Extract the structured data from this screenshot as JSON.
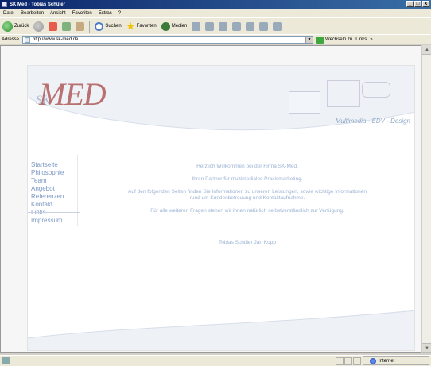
{
  "window": {
    "title": "SK Med - Tobias Schüler",
    "min": "_",
    "max": "□",
    "close": "x"
  },
  "menu": [
    "Datei",
    "Bearbeiten",
    "Ansicht",
    "Favoriten",
    "Extras",
    "?"
  ],
  "toolbar": {
    "back": "Zurück",
    "search": "Suchen",
    "favorites": "Favoriten",
    "media": "Medien"
  },
  "address": {
    "label": "Adresse",
    "url": "http://www.sk-med.de",
    "go": "Wechseln zu",
    "links": "Links"
  },
  "site": {
    "logo": "MED",
    "logo_prefix": "SK",
    "tagline": "Multimedia - EDV - Design",
    "nav": [
      "Startseite",
      "Philosophie",
      "Team",
      "Angebot",
      "Referenzen",
      "Kontakt",
      "Links",
      "Impressum"
    ],
    "content": {
      "welcome": "Herzlich Willkommen bei der Firma SK-Med.",
      "partner": "Ihren Partner für multimediales Praxismarketing.",
      "info": "Auf den folgenden Seiten finden Sie Informationen zu unseren Leistungen, sowie wichtige Informationen rund um Kundenbetreuung und Kontaktaufnahme.",
      "questions": "Für alle weiteren Fragen stehen wir ihnen natürlich selbstverständlich zur Verfügung.",
      "signature": "Tobias Schüler Jan Kopp"
    }
  },
  "status": {
    "zone": "Internet"
  }
}
